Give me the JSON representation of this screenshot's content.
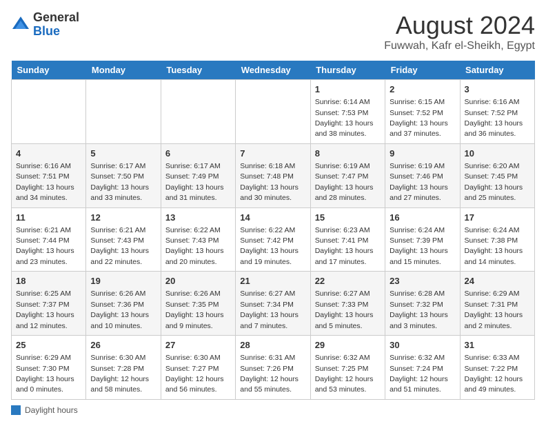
{
  "header": {
    "logo_general": "General",
    "logo_blue": "Blue",
    "title": "August 2024",
    "subtitle": "Fuwwah, Kafr el-Sheikh, Egypt"
  },
  "days_of_week": [
    "Sunday",
    "Monday",
    "Tuesday",
    "Wednesday",
    "Thursday",
    "Friday",
    "Saturday"
  ],
  "weeks": [
    [
      {
        "day": "",
        "info": ""
      },
      {
        "day": "",
        "info": ""
      },
      {
        "day": "",
        "info": ""
      },
      {
        "day": "",
        "info": ""
      },
      {
        "day": "1",
        "info": "Sunrise: 6:14 AM\nSunset: 7:53 PM\nDaylight: 13 hours\nand 38 minutes."
      },
      {
        "day": "2",
        "info": "Sunrise: 6:15 AM\nSunset: 7:52 PM\nDaylight: 13 hours\nand 37 minutes."
      },
      {
        "day": "3",
        "info": "Sunrise: 6:16 AM\nSunset: 7:52 PM\nDaylight: 13 hours\nand 36 minutes."
      }
    ],
    [
      {
        "day": "4",
        "info": "Sunrise: 6:16 AM\nSunset: 7:51 PM\nDaylight: 13 hours\nand 34 minutes."
      },
      {
        "day": "5",
        "info": "Sunrise: 6:17 AM\nSunset: 7:50 PM\nDaylight: 13 hours\nand 33 minutes."
      },
      {
        "day": "6",
        "info": "Sunrise: 6:17 AM\nSunset: 7:49 PM\nDaylight: 13 hours\nand 31 minutes."
      },
      {
        "day": "7",
        "info": "Sunrise: 6:18 AM\nSunset: 7:48 PM\nDaylight: 13 hours\nand 30 minutes."
      },
      {
        "day": "8",
        "info": "Sunrise: 6:19 AM\nSunset: 7:47 PM\nDaylight: 13 hours\nand 28 minutes."
      },
      {
        "day": "9",
        "info": "Sunrise: 6:19 AM\nSunset: 7:46 PM\nDaylight: 13 hours\nand 27 minutes."
      },
      {
        "day": "10",
        "info": "Sunrise: 6:20 AM\nSunset: 7:45 PM\nDaylight: 13 hours\nand 25 minutes."
      }
    ],
    [
      {
        "day": "11",
        "info": "Sunrise: 6:21 AM\nSunset: 7:44 PM\nDaylight: 13 hours\nand 23 minutes."
      },
      {
        "day": "12",
        "info": "Sunrise: 6:21 AM\nSunset: 7:43 PM\nDaylight: 13 hours\nand 22 minutes."
      },
      {
        "day": "13",
        "info": "Sunrise: 6:22 AM\nSunset: 7:43 PM\nDaylight: 13 hours\nand 20 minutes."
      },
      {
        "day": "14",
        "info": "Sunrise: 6:22 AM\nSunset: 7:42 PM\nDaylight: 13 hours\nand 19 minutes."
      },
      {
        "day": "15",
        "info": "Sunrise: 6:23 AM\nSunset: 7:41 PM\nDaylight: 13 hours\nand 17 minutes."
      },
      {
        "day": "16",
        "info": "Sunrise: 6:24 AM\nSunset: 7:39 PM\nDaylight: 13 hours\nand 15 minutes."
      },
      {
        "day": "17",
        "info": "Sunrise: 6:24 AM\nSunset: 7:38 PM\nDaylight: 13 hours\nand 14 minutes."
      }
    ],
    [
      {
        "day": "18",
        "info": "Sunrise: 6:25 AM\nSunset: 7:37 PM\nDaylight: 13 hours\nand 12 minutes."
      },
      {
        "day": "19",
        "info": "Sunrise: 6:26 AM\nSunset: 7:36 PM\nDaylight: 13 hours\nand 10 minutes."
      },
      {
        "day": "20",
        "info": "Sunrise: 6:26 AM\nSunset: 7:35 PM\nDaylight: 13 hours\nand 9 minutes."
      },
      {
        "day": "21",
        "info": "Sunrise: 6:27 AM\nSunset: 7:34 PM\nDaylight: 13 hours\nand 7 minutes."
      },
      {
        "day": "22",
        "info": "Sunrise: 6:27 AM\nSunset: 7:33 PM\nDaylight: 13 hours\nand 5 minutes."
      },
      {
        "day": "23",
        "info": "Sunrise: 6:28 AM\nSunset: 7:32 PM\nDaylight: 13 hours\nand 3 minutes."
      },
      {
        "day": "24",
        "info": "Sunrise: 6:29 AM\nSunset: 7:31 PM\nDaylight: 13 hours\nand 2 minutes."
      }
    ],
    [
      {
        "day": "25",
        "info": "Sunrise: 6:29 AM\nSunset: 7:30 PM\nDaylight: 13 hours\nand 0 minutes."
      },
      {
        "day": "26",
        "info": "Sunrise: 6:30 AM\nSunset: 7:28 PM\nDaylight: 12 hours\nand 58 minutes."
      },
      {
        "day": "27",
        "info": "Sunrise: 6:30 AM\nSunset: 7:27 PM\nDaylight: 12 hours\nand 56 minutes."
      },
      {
        "day": "28",
        "info": "Sunrise: 6:31 AM\nSunset: 7:26 PM\nDaylight: 12 hours\nand 55 minutes."
      },
      {
        "day": "29",
        "info": "Sunrise: 6:32 AM\nSunset: 7:25 PM\nDaylight: 12 hours\nand 53 minutes."
      },
      {
        "day": "30",
        "info": "Sunrise: 6:32 AM\nSunset: 7:24 PM\nDaylight: 12 hours\nand 51 minutes."
      },
      {
        "day": "31",
        "info": "Sunrise: 6:33 AM\nSunset: 7:22 PM\nDaylight: 12 hours\nand 49 minutes."
      }
    ]
  ],
  "footer": {
    "label": "Daylight hours"
  }
}
